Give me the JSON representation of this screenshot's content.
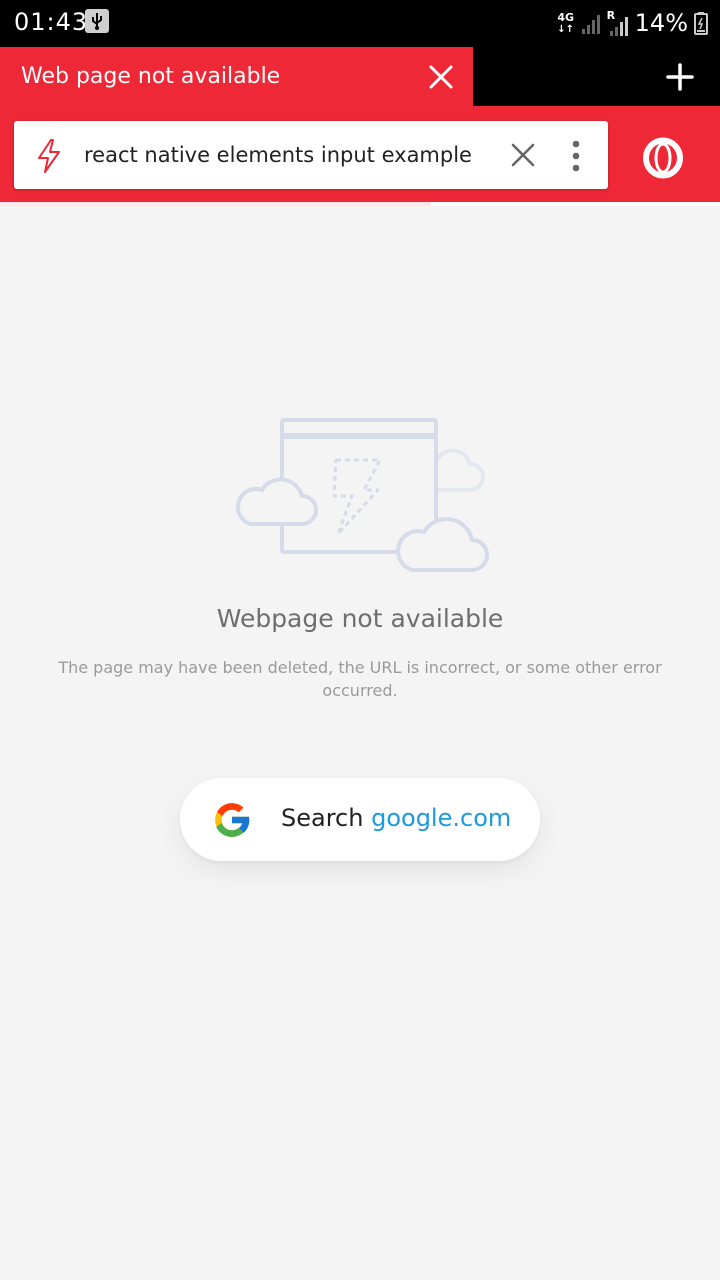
{
  "status_bar": {
    "time": "01:43",
    "network_type": "4G",
    "roaming_indicator": "R",
    "battery_percent": "14%"
  },
  "tab": {
    "title": "Web page not available"
  },
  "address_bar": {
    "query": "react native elements input example"
  },
  "error_page": {
    "title": "Webpage not available",
    "description": "The page may have been deleted, the URL is incorrect, or some other error occurred.",
    "search_prefix": "Search",
    "search_domain": "google.com"
  },
  "colors": {
    "accent": "#ee2837",
    "link": "#1a9be0",
    "illustration": "#d5dbe8"
  },
  "icons": [
    "usb-icon",
    "signal-icon",
    "battery-icon",
    "close-icon",
    "plus-icon",
    "bolt-icon",
    "clear-icon",
    "more-vert-icon",
    "opera-logo-icon",
    "google-logo-icon"
  ]
}
